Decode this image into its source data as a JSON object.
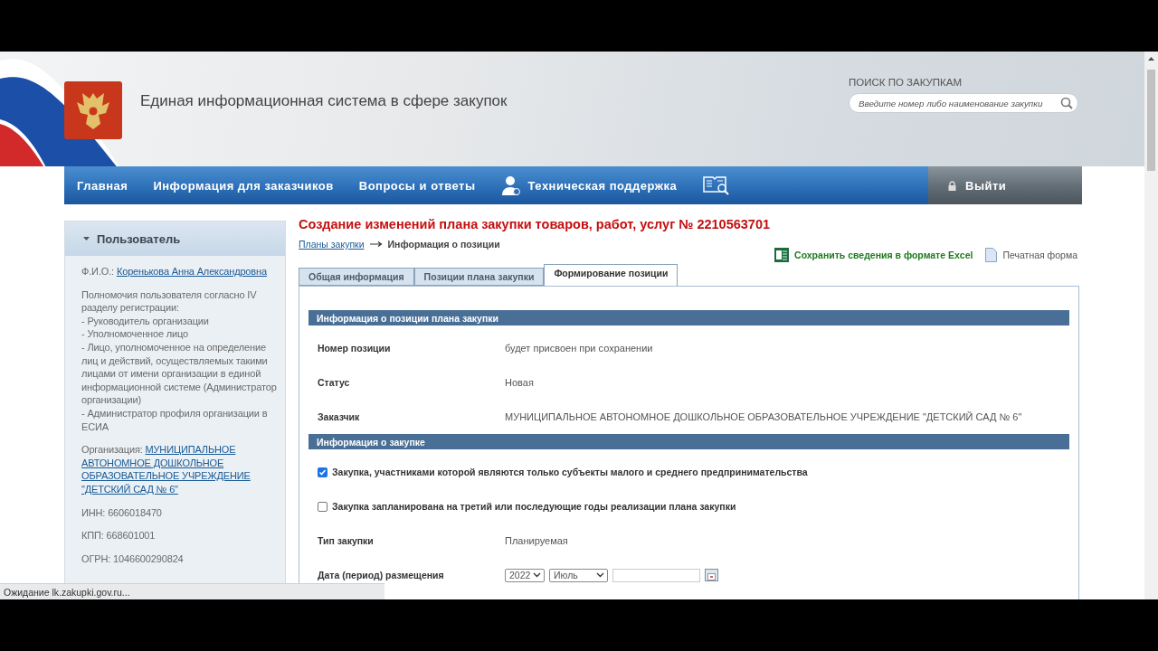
{
  "header": {
    "title": "Единая информационная система в сфере закупок",
    "search_label": "ПОИСК ПО ЗАКУПКАМ",
    "search_placeholder": "Введите номер либо наименование закупки"
  },
  "nav": {
    "items": [
      {
        "label": "Главная",
        "kind": "link"
      },
      {
        "label": "Информация для заказчиков",
        "kind": "link"
      },
      {
        "label": "Вопросы и ответы",
        "kind": "link"
      },
      {
        "label": "Техническая поддержка",
        "kind": "support"
      },
      {
        "kind": "catalog"
      }
    ],
    "logout": "Выйти"
  },
  "sidebar": {
    "title": "Пользователь",
    "fio_label": "Ф.И.О.:",
    "fio_name": "Коренькова Анна Александровна",
    "powers": [
      "Полномочия пользователя согласно IV разделу регистрации:",
      "- Руководитель организации",
      "- Уполномоченное лицо",
      "- Лицо, уполномоченное на определение лиц и действий, осуществляемых такими лицами от имени организации в единой информационной системе (Администратор организации)",
      "- Администратор профиля организации в ЕСИА"
    ],
    "org_label": "Организация:",
    "org_name": "МУНИЦИПАЛЬНОЕ АВТОНОМНОЕ ДОШКОЛЬНОЕ ОБРАЗОВАТЕЛЬНОЕ УЧРЕЖДЕНИЕ \"ДЕТСКИЙ САД № 6\"",
    "details": [
      "ИНН: 6606018470",
      "КПП: 668601001",
      "ОГРН: 1046600290824"
    ]
  },
  "page_title": "Создание изменений плана закупки товаров, работ, услуг № 2210563701",
  "breadcrumbs": {
    "link": "Планы закупки",
    "current": "Информация о позиции"
  },
  "actions": [
    {
      "label": "Сохранить сведения в формате Excel",
      "kind": "excel"
    },
    {
      "label": "Печатная форма",
      "kind": "print"
    }
  ],
  "tabs": [
    {
      "label": "Общая информация",
      "selected": false
    },
    {
      "label": "Позиции плана закупки",
      "selected": false
    },
    {
      "label": "Формирование позиции",
      "selected": true
    }
  ],
  "sections": [
    {
      "title": "Информация о позиции плана закупки",
      "rows": [
        {
          "kind": "field",
          "label": "Номер позиции",
          "value": "будет присвоен при сохранении"
        },
        {
          "kind": "field",
          "label": "Статус",
          "value": "Новая"
        },
        {
          "kind": "field",
          "label": "Заказчик",
          "value": "МУНИЦИПАЛЬНОЕ АВТОНОМНОЕ ДОШКОЛЬНОЕ ОБРАЗОВАТЕЛЬНОЕ УЧРЕЖДЕНИЕ \"ДЕТСКИЙ САД № 6\""
        }
      ]
    },
    {
      "title": "Информация о закупке",
      "rows": [
        {
          "kind": "checkbox",
          "label": "Закупка, участниками которой являются только субъекты малого и среднего предпринимательства",
          "checked": true
        },
        {
          "kind": "checkbox",
          "label": "Закупка запланирована на третий или последующие годы реализации плана закупки",
          "checked": false
        },
        {
          "kind": "field",
          "label": "Тип закупки",
          "value": "Планируемая"
        },
        {
          "kind": "date",
          "label": "Дата (период) размещения",
          "year": "2022",
          "month": "Июль"
        }
      ]
    }
  ],
  "status_bar": "Ожидание lk.zakupki.gov.ru..."
}
